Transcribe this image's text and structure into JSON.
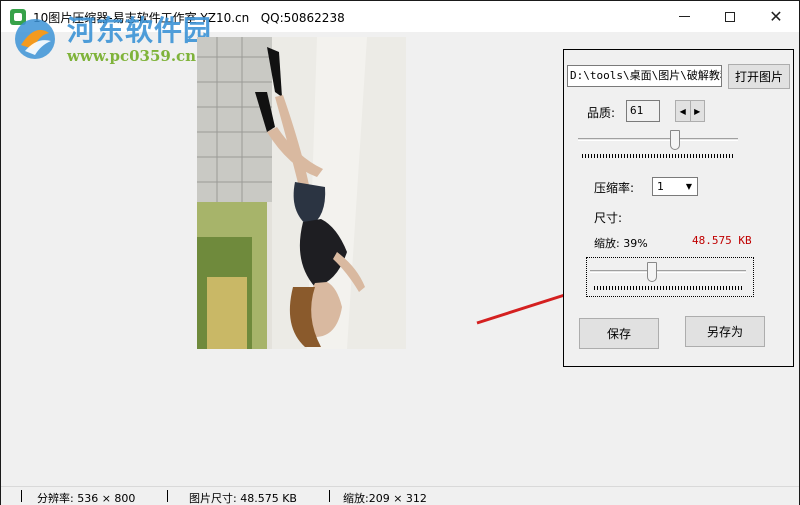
{
  "window": {
    "title": "10图片压缩器-易志软件工作室 YZ10.cn   QQ:50862238"
  },
  "watermark": {
    "site_name": "河东软件园",
    "site_url": "www.pc0359.cn"
  },
  "panel": {
    "path_value": "D:\\tools\\桌面\\图片\\破解教程",
    "open_button": "打开图片",
    "quality_label": "品质:",
    "quality_value": "61",
    "quality_slider_value": 61,
    "ratio_label": "压缩率:",
    "ratio_value": "1",
    "size_label": "尺寸:",
    "zoom_label": "缩放: 39%",
    "size_value": "48.575 KB",
    "scale_slider_value": 39,
    "save_button": "保存",
    "save_as_button": "另存为"
  },
  "status": {
    "resolution": "分辨率: 536 × 800",
    "image_size": "图片尺寸: 48.575 KB",
    "scale": "缩放:209 × 312"
  },
  "colors": {
    "size_value": "#c00000",
    "arrow": "#d42020",
    "watermark_blue": "#3c93d6",
    "watermark_green": "#7fb33a"
  }
}
